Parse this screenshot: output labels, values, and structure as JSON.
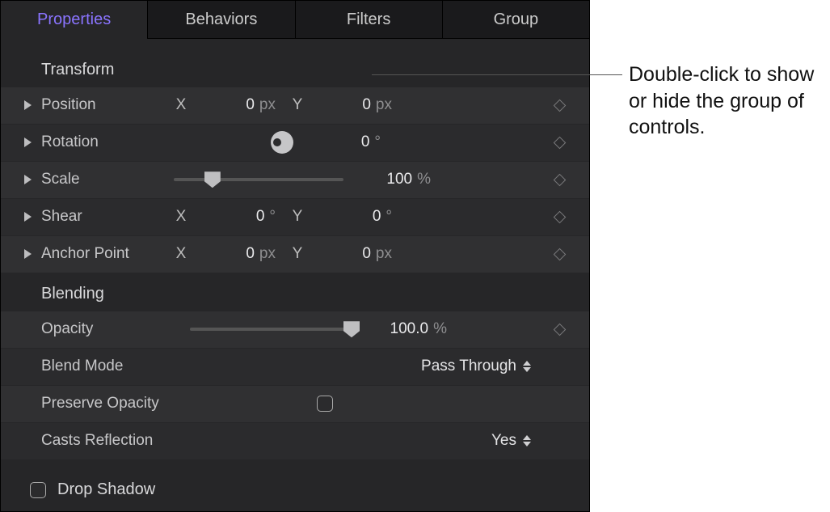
{
  "tabs": [
    "Properties",
    "Behaviors",
    "Filters",
    "Group"
  ],
  "active_tab": "Properties",
  "sections": {
    "transform": {
      "title": "Transform",
      "position": {
        "label": "Position",
        "x": "0",
        "xunit": "px",
        "y": "0",
        "yunit": "px"
      },
      "rotation": {
        "label": "Rotation",
        "value": "0",
        "unit": "°"
      },
      "scale": {
        "label": "Scale",
        "value": "100",
        "unit": "%",
        "slider_pct": 18
      },
      "shear": {
        "label": "Shear",
        "x": "0",
        "xunit": "°",
        "y": "0",
        "yunit": "°"
      },
      "anchor": {
        "label": "Anchor Point",
        "x": "0",
        "xunit": "px",
        "y": "0",
        "yunit": "px"
      }
    },
    "blending": {
      "title": "Blending",
      "opacity": {
        "label": "Opacity",
        "value": "100.0",
        "unit": "%",
        "slider_pct": 100
      },
      "blendmode": {
        "label": "Blend Mode",
        "value": "Pass Through"
      },
      "preserve": {
        "label": "Preserve Opacity",
        "checked": false
      },
      "casts": {
        "label": "Casts Reflection",
        "value": "Yes"
      }
    },
    "dropshadow": {
      "label": "Drop Shadow",
      "checked": false
    }
  },
  "callout": "Double-click to show or hide the group of controls."
}
